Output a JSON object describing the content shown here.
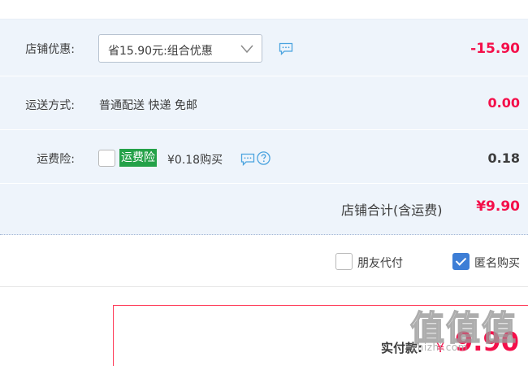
{
  "order": {
    "shop_discount": {
      "label": "店铺优惠:",
      "selected": "省15.90元:组合优惠",
      "amount": "-15.90"
    },
    "shipping": {
      "label": "运送方式:",
      "method": "普通配送 快递 免邮",
      "amount": "0.00"
    },
    "insurance": {
      "label": "运费险:",
      "badge": "运费险",
      "price_text": "¥0.18购买",
      "checked": false,
      "amount": "0.18"
    },
    "subtotal": {
      "label": "店铺合计(含运费)",
      "amount": "¥9.90"
    }
  },
  "options": {
    "friend_pay_label": "朋友代付",
    "friend_pay_checked": false,
    "anonymous_label": "匿名购买",
    "anonymous_checked": true
  },
  "payment": {
    "label": "实付款:",
    "symbol": "¥",
    "amount": "9.90"
  },
  "watermark": {
    "glyphs": [
      "值",
      "值",
      "值"
    ],
    "text": "zhizhi.com"
  },
  "colors": {
    "price_red": "#f40f4a",
    "panel_bg": "#eef4fb",
    "insurance_green": "#24a148",
    "checkbox_blue": "#3d7ed6",
    "icon_blue": "#4aa3df"
  },
  "icons": {
    "discount_dropdown": "chevron-down-icon",
    "message": "message-bubble-icon",
    "help": "question-circle-icon",
    "check": "checkmark-icon"
  }
}
